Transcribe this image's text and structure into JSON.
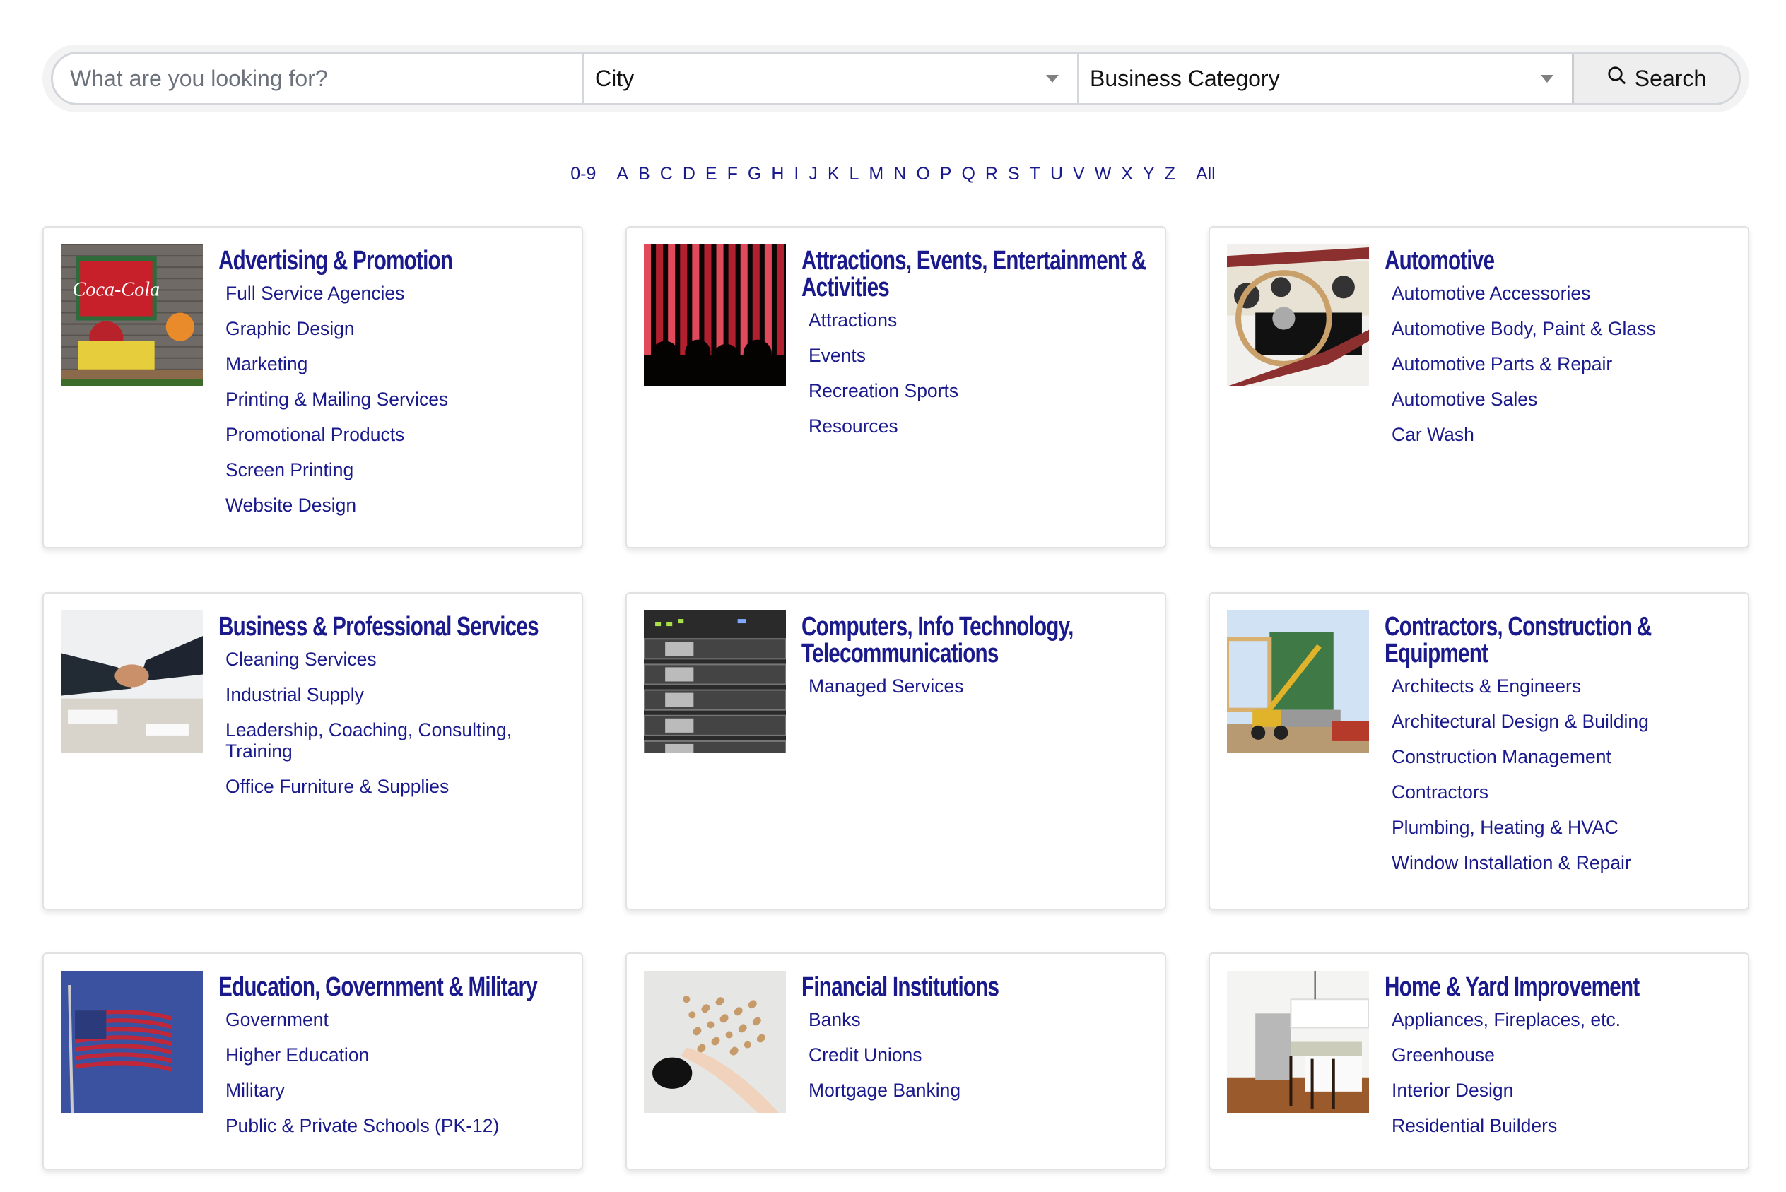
{
  "search": {
    "placeholder": "What are you looking for?",
    "value": "",
    "city_label": "City",
    "category_label": "Business Category",
    "button_label": "Search",
    "button_icon": "search-icon"
  },
  "alphabet": [
    "0-9",
    "A",
    "B",
    "C",
    "D",
    "E",
    "F",
    "G",
    "H",
    "I",
    "J",
    "K",
    "L",
    "M",
    "N",
    "O",
    "P",
    "Q",
    "R",
    "S",
    "T",
    "U",
    "V",
    "W",
    "X",
    "Y",
    "Z",
    "All"
  ],
  "colors": {
    "link": "#1a1a8c",
    "placeholder": "#6c727c",
    "button_bg": "#eeeeee"
  },
  "categories": [
    {
      "title": "Advertising & Promotion",
      "image": "vintage-signs-image",
      "items": [
        "Full Service Agencies",
        "Graphic Design",
        "Marketing",
        "Printing & Mailing Services",
        "Promotional Products",
        "Screen Printing",
        "Website Design"
      ]
    },
    {
      "title": "Attractions, Events, Entertainment & Activities",
      "image": "theater-curtain-image",
      "items": [
        "Attractions",
        "Events",
        "Recreation Sports",
        "Resources"
      ]
    },
    {
      "title": "Automotive",
      "image": "car-dashboard-image",
      "items": [
        "Automotive Accessories",
        "Automotive Body, Paint & Glass",
        "Automotive Parts & Repair",
        "Automotive Sales",
        "Car Wash"
      ]
    },
    {
      "title": "Business & Professional Services",
      "image": "handshake-image",
      "items": [
        "Cleaning Services",
        "Industrial Supply",
        "Leadership, Coaching, Consulting, Training",
        "Office Furniture & Supplies"
      ]
    },
    {
      "title": "Computers, Info Technology, Telecommunications",
      "image": "server-rack-image",
      "items": [
        "Managed Services"
      ]
    },
    {
      "title": "Contractors, Construction & Equipment",
      "image": "construction-site-image",
      "items": [
        "Architects & Engineers",
        "Architectural Design & Building",
        "Construction Management",
        "Contractors",
        "Plumbing, Heating & HVAC",
        "Window Installation & Repair"
      ]
    },
    {
      "title": "Education, Government & Military",
      "image": "american-flag-image",
      "items": [
        "Government",
        "Higher Education",
        "Military",
        "Public & Private Schools (PK-12)"
      ]
    },
    {
      "title": "Financial Institutions",
      "image": "piggy-bank-image",
      "items": [
        "Banks",
        "Credit Unions",
        "Mortgage Banking"
      ]
    },
    {
      "title": "Home & Yard Improvement",
      "image": "kitchen-image",
      "items": [
        "Appliances, Fireplaces, etc.",
        "Greenhouse",
        "Interior Design",
        "Residential Builders"
      ]
    }
  ]
}
